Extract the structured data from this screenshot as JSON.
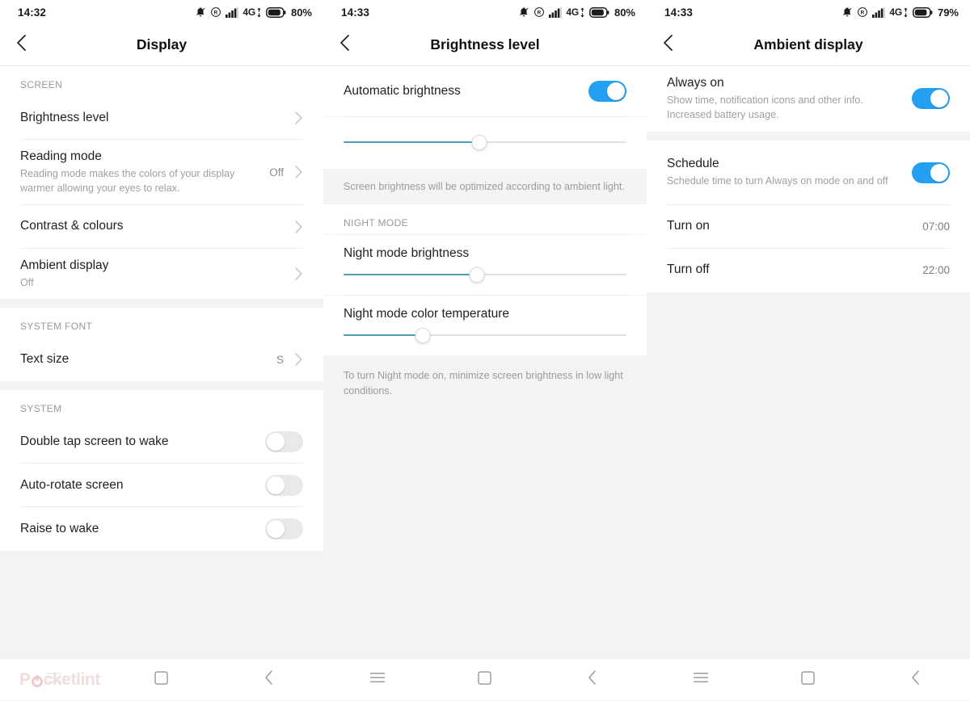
{
  "screens": [
    {
      "status": {
        "time": "14:32",
        "battery_pct": "80%",
        "network": "4G",
        "icons": [
          "bell-muted-icon",
          "ringer-r-icon",
          "signal-bars-icon",
          "data-arrows-icon",
          "battery-icon"
        ]
      },
      "appbar": {
        "title": "Display",
        "back_icon": "chevron-left-icon"
      },
      "groups": [
        {
          "header": "SCREEN",
          "rows": [
            {
              "title": "Brightness level",
              "sub": "",
              "value": "",
              "control": "chevron"
            },
            {
              "title": "Reading mode",
              "sub": "Reading mode makes the colors of your display warmer allowing your eyes to relax.",
              "value": "Off",
              "control": "chevron"
            },
            {
              "title": "Contrast & colours",
              "sub": "",
              "value": "",
              "control": "chevron"
            },
            {
              "title": "Ambient display",
              "sub": "Off",
              "value": "",
              "control": "chevron"
            }
          ]
        },
        {
          "header": "SYSTEM FONT",
          "rows": [
            {
              "title": "Text size",
              "sub": "",
              "value": "S",
              "control": "chevron"
            }
          ]
        },
        {
          "header": "SYSTEM",
          "rows": [
            {
              "title": "Double tap screen to wake",
              "sub": "",
              "value": "",
              "control": "toggle-off"
            },
            {
              "title": "Auto-rotate screen",
              "sub": "",
              "value": "",
              "control": "toggle-off"
            },
            {
              "title": "Raise to wake",
              "sub": "",
              "value": "",
              "control": "toggle-off"
            }
          ]
        }
      ],
      "nav": {
        "recents_icon": "menu-icon",
        "home_icon": "square-icon",
        "back_icon": "chevron-left-icon",
        "watermark": "Pocketlint",
        "show_watermark": true,
        "hide_recents": true
      }
    },
    {
      "status": {
        "time": "14:33",
        "battery_pct": "80%",
        "network": "4G",
        "icons": [
          "bell-muted-icon",
          "ringer-r-icon",
          "signal-bars-icon",
          "data-arrows-icon",
          "battery-icon"
        ]
      },
      "appbar": {
        "title": "Brightness level",
        "back_icon": "chevron-left-icon"
      },
      "auto_brightness": {
        "title": "Automatic brightness",
        "toggle": "on"
      },
      "brightness_slider": {
        "value_pct": 48
      },
      "auto_note": "Screen brightness will be optimized according to ambient light.",
      "night_mode": {
        "header": "NIGHT MODE",
        "brightness": {
          "label": "Night mode brightness",
          "value_pct": 47
        },
        "temperature": {
          "label": "Night mode color temperature",
          "value_pct": 28
        },
        "note": "To turn Night mode on, minimize screen brightness in low light conditions."
      },
      "nav": {
        "recents_icon": "menu-icon",
        "home_icon": "square-icon",
        "back_icon": "chevron-left-icon",
        "show_watermark": false,
        "hide_recents": false
      }
    },
    {
      "status": {
        "time": "14:33",
        "battery_pct": "79%",
        "network": "4G",
        "icons": [
          "bell-muted-icon",
          "ringer-r-icon",
          "signal-bars-icon",
          "data-arrows-icon",
          "battery-icon"
        ]
      },
      "appbar": {
        "title": "Ambient display",
        "back_icon": "chevron-left-icon"
      },
      "always_on": {
        "title": "Always on",
        "sub": "Show time, notification icons and other info. Increased battery usage.",
        "toggle": "on"
      },
      "schedule": {
        "title": "Schedule",
        "sub": "Schedule time to turn Always on mode on and off",
        "toggle": "on"
      },
      "turn_on": {
        "title": "Turn on",
        "value": "07:00"
      },
      "turn_off": {
        "title": "Turn off",
        "value": "22:00"
      },
      "nav": {
        "recents_icon": "menu-icon",
        "home_icon": "square-icon",
        "back_icon": "chevron-left-icon",
        "show_watermark": false,
        "hide_recents": false
      }
    }
  ],
  "colors": {
    "accent_toggle": "#24a0f2",
    "slider_fill": "#4f9db0",
    "track": "#e0e0e0",
    "page_bg": "#f3f3f3"
  }
}
